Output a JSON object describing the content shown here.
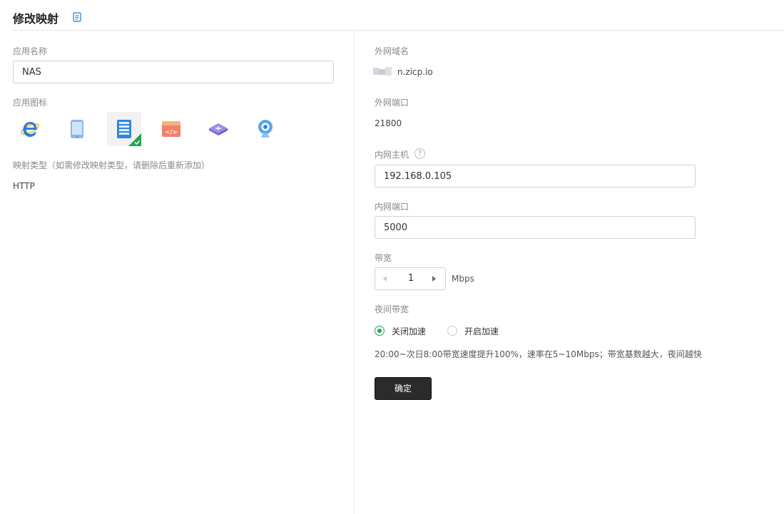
{
  "header": {
    "title": "修改映射",
    "doc_icon": "doc-icon"
  },
  "left": {
    "app_name_label": "应用名称",
    "app_name_value": "NAS",
    "app_icon_label": "应用图标",
    "icons": [
      {
        "name": "ie-browser-icon",
        "selected": false
      },
      {
        "name": "tablet-icon",
        "selected": false
      },
      {
        "name": "nas-server-icon",
        "selected": true
      },
      {
        "name": "code-window-icon",
        "selected": false
      },
      {
        "name": "router-icon",
        "selected": false
      },
      {
        "name": "webcam-icon",
        "selected": false
      }
    ],
    "mapping_type_label": "映射类型（如需修改映射类型，请删除后重新添加）",
    "mapping_type_value": "HTTP"
  },
  "right": {
    "domain_label": "外网域名",
    "domain_value": "n.zicp.io",
    "ext_port_label": "外网端口",
    "ext_port_value": "21800",
    "host_label": "内网主机",
    "host_value": "192.168.0.105",
    "int_port_label": "内网端口",
    "int_port_value": "5000",
    "bandwidth_label": "带宽",
    "bandwidth_value": "1",
    "bandwidth_unit": "Mbps",
    "night_label": "夜间带宽",
    "radio_off_label": "关闭加速",
    "radio_on_label": "开启加速",
    "night_note": "20:00~次日8:00带宽速度提升100%，速率在5~10Mbps；带宽基数越大，夜间越快",
    "confirm_label": "确定"
  },
  "colors": {
    "accent_green": "#22a84b",
    "confirm_bg": "#2b2b2b"
  }
}
